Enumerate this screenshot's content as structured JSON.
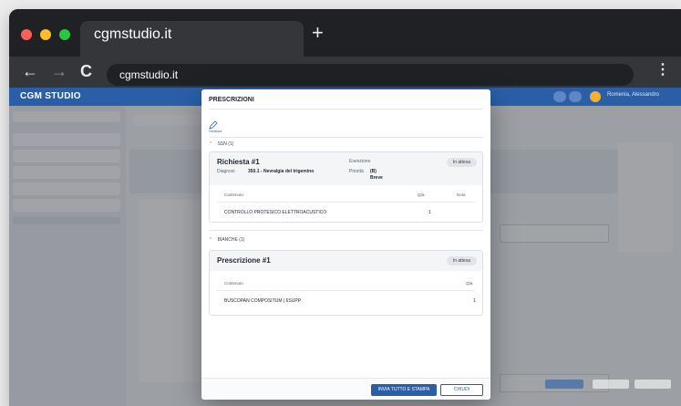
{
  "browser": {
    "tab_title": "cgmstudio.it",
    "url": "cgmstudio.it",
    "new_tab_glyph": "+",
    "back_glyph": "←",
    "forward_glyph": "→",
    "reload_glyph": "C",
    "menu_glyph": "⋮"
  },
  "app": {
    "title": "CGM STUDIO",
    "user": "Romenia, Alessandro"
  },
  "modal": {
    "title": "PRESCRIZIONI",
    "tool_label": "Gestisci",
    "ssn": {
      "section_label": "SSN (1)",
      "card_title": "Richiesta #1",
      "status": "In attesa",
      "diagnosis_label": "Diagnosi",
      "diagnosis_value": "350.1 - Nevralgia del trigemino",
      "exemption_label": "Esenzione",
      "priority_label": "Priorità",
      "priority_code": "(B)",
      "priority_text": "Breve",
      "col_content": "Contenuto",
      "col_qty": "Qtà.",
      "col_note": "Nota",
      "rows": [
        {
          "content": "CONTROLLO PROTESICO ELETTROACUSTICO",
          "qty": "1",
          "note": ""
        }
      ]
    },
    "bianche": {
      "section_label": "BIANCHE (1)",
      "card_title": "Prescrizione #1",
      "status": "In attesa",
      "col_content": "Contenuto",
      "col_qty": "Qtà.",
      "rows": [
        {
          "content": "BUSCOPAN COMPOSITUM | 6SUPP",
          "qty": "1"
        }
      ]
    },
    "primary_button": "INVIA TUTTO E STAMPA",
    "secondary_button": "CHIUDI"
  },
  "colors": {
    "accent": "#2a5fa8",
    "status_pill": "#e2e4e8"
  }
}
